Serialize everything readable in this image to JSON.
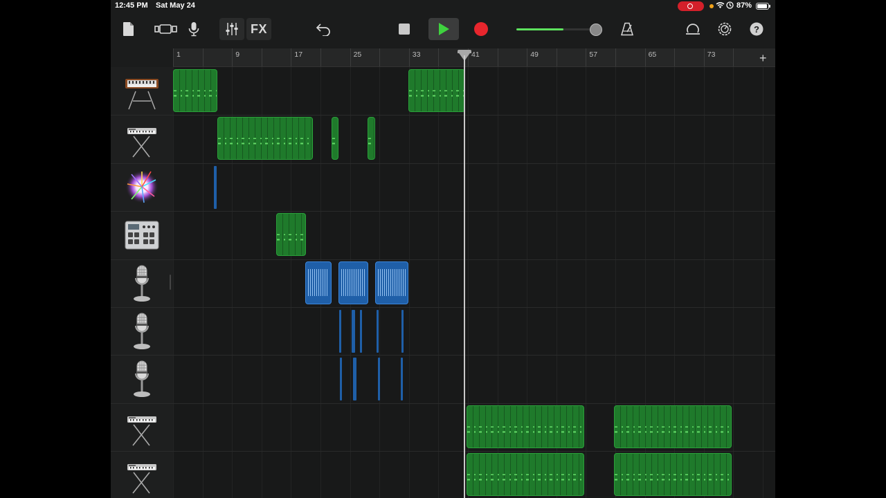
{
  "status": {
    "time": "12:45 PM",
    "date": "Sat May 24",
    "battery": "87%"
  },
  "toolbar": {
    "fx_label": "FX",
    "icons": [
      "browser-icon",
      "tracks-view-icon",
      "microphone-icon",
      "mixer-icon",
      "undo-icon",
      "stop-icon",
      "play-icon",
      "record-icon",
      "metronome-icon",
      "loop-icon",
      "settings-icon",
      "help-icon"
    ],
    "volume_fraction": 0.62
  },
  "ruler": {
    "labels": [
      "1",
      "9",
      "17",
      "25",
      "33",
      "41",
      "49",
      "57",
      "65",
      "73"
    ],
    "add_label": "+"
  },
  "tracks": [
    {
      "name": "synth-analog-track",
      "icon": "analog-synth-icon"
    },
    {
      "name": "keyboard-track",
      "icon": "keyboard-stand-icon"
    },
    {
      "name": "sampler-track",
      "icon": "sparkle-sampler-icon"
    },
    {
      "name": "drum-machine-track",
      "icon": "drum-machine-icon"
    },
    {
      "name": "vocal-track-1",
      "icon": "microphone-stand-icon"
    },
    {
      "name": "vocal-track-2",
      "icon": "microphone-stand-icon"
    },
    {
      "name": "vocal-track-3",
      "icon": "microphone-stand-icon"
    },
    {
      "name": "keyboard-track-2",
      "icon": "keyboard-stand-icon"
    },
    {
      "name": "keyboard-track-3",
      "icon": "keyboard-stand-icon"
    }
  ],
  "colors": {
    "midi_region": "#1f7a2b",
    "audio_region": "#1f5fa8",
    "record": "#e8262d",
    "play": "#3fd23f",
    "volume": "#5ee35e"
  }
}
